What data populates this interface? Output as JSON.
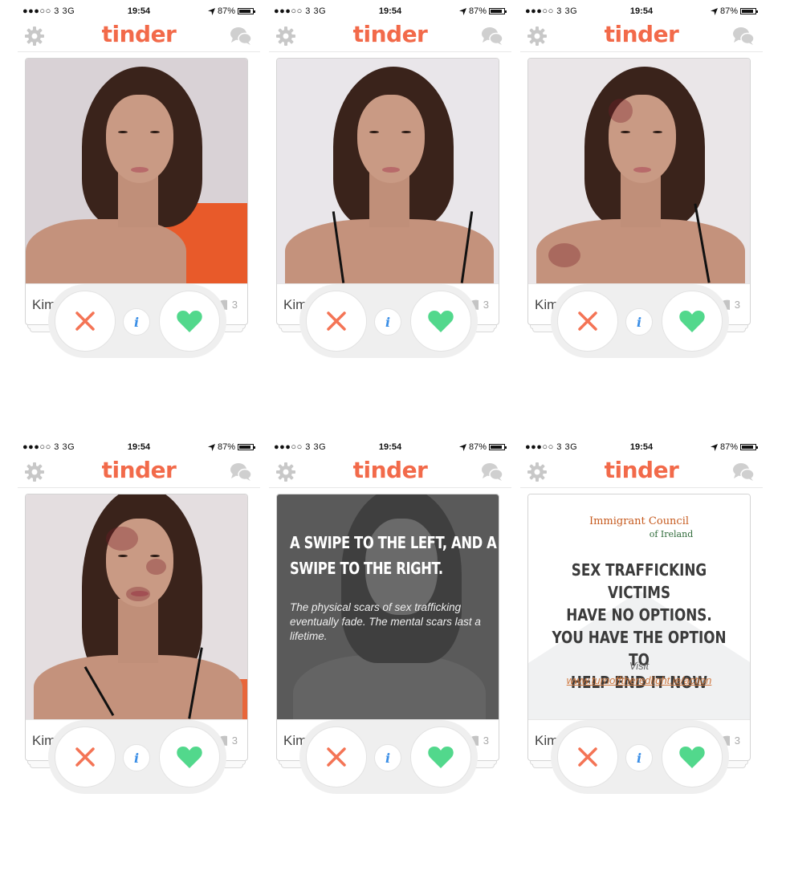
{
  "status_bar": {
    "carrier": "●●●○○ 3  3G",
    "time": "19:54",
    "battery": "87%"
  },
  "app": {
    "logo_text": "tinder"
  },
  "profile": {
    "name": "Kim, 29",
    "friends_count": "0",
    "interests_count": "3"
  },
  "ad_panel_dark": {
    "headline": "A SWIPE TO THE LEFT, AND A SWIPE TO THE RIGHT.",
    "subtext": "The physical scars of sex trafficking eventually fade. The mental scars last a lifetime."
  },
  "ad_panel_light": {
    "org_line1": "Immigrant Council",
    "org_line2": "of Ireland",
    "cta_line1": "SEX TRAFFICKING VICTIMS",
    "cta_line2": "HAVE NO OPTIONS.",
    "cta_line3": "YOU HAVE THE OPTION TO",
    "cta_line4": "HELP END IT NOW",
    "visit": "Visit",
    "url": "www.turnofftheredlight.ie/action"
  },
  "colors": {
    "brand": "#f26a4a",
    "nope": "#f47455",
    "like": "#52d88c",
    "info": "#3a8ee6"
  },
  "icons": [
    "settings-gear-icon",
    "chat-bubbles-icon",
    "location-arrow-icon",
    "battery-icon",
    "friends-icon",
    "book-icon",
    "nope-x-icon",
    "info-icon",
    "heart-icon"
  ]
}
